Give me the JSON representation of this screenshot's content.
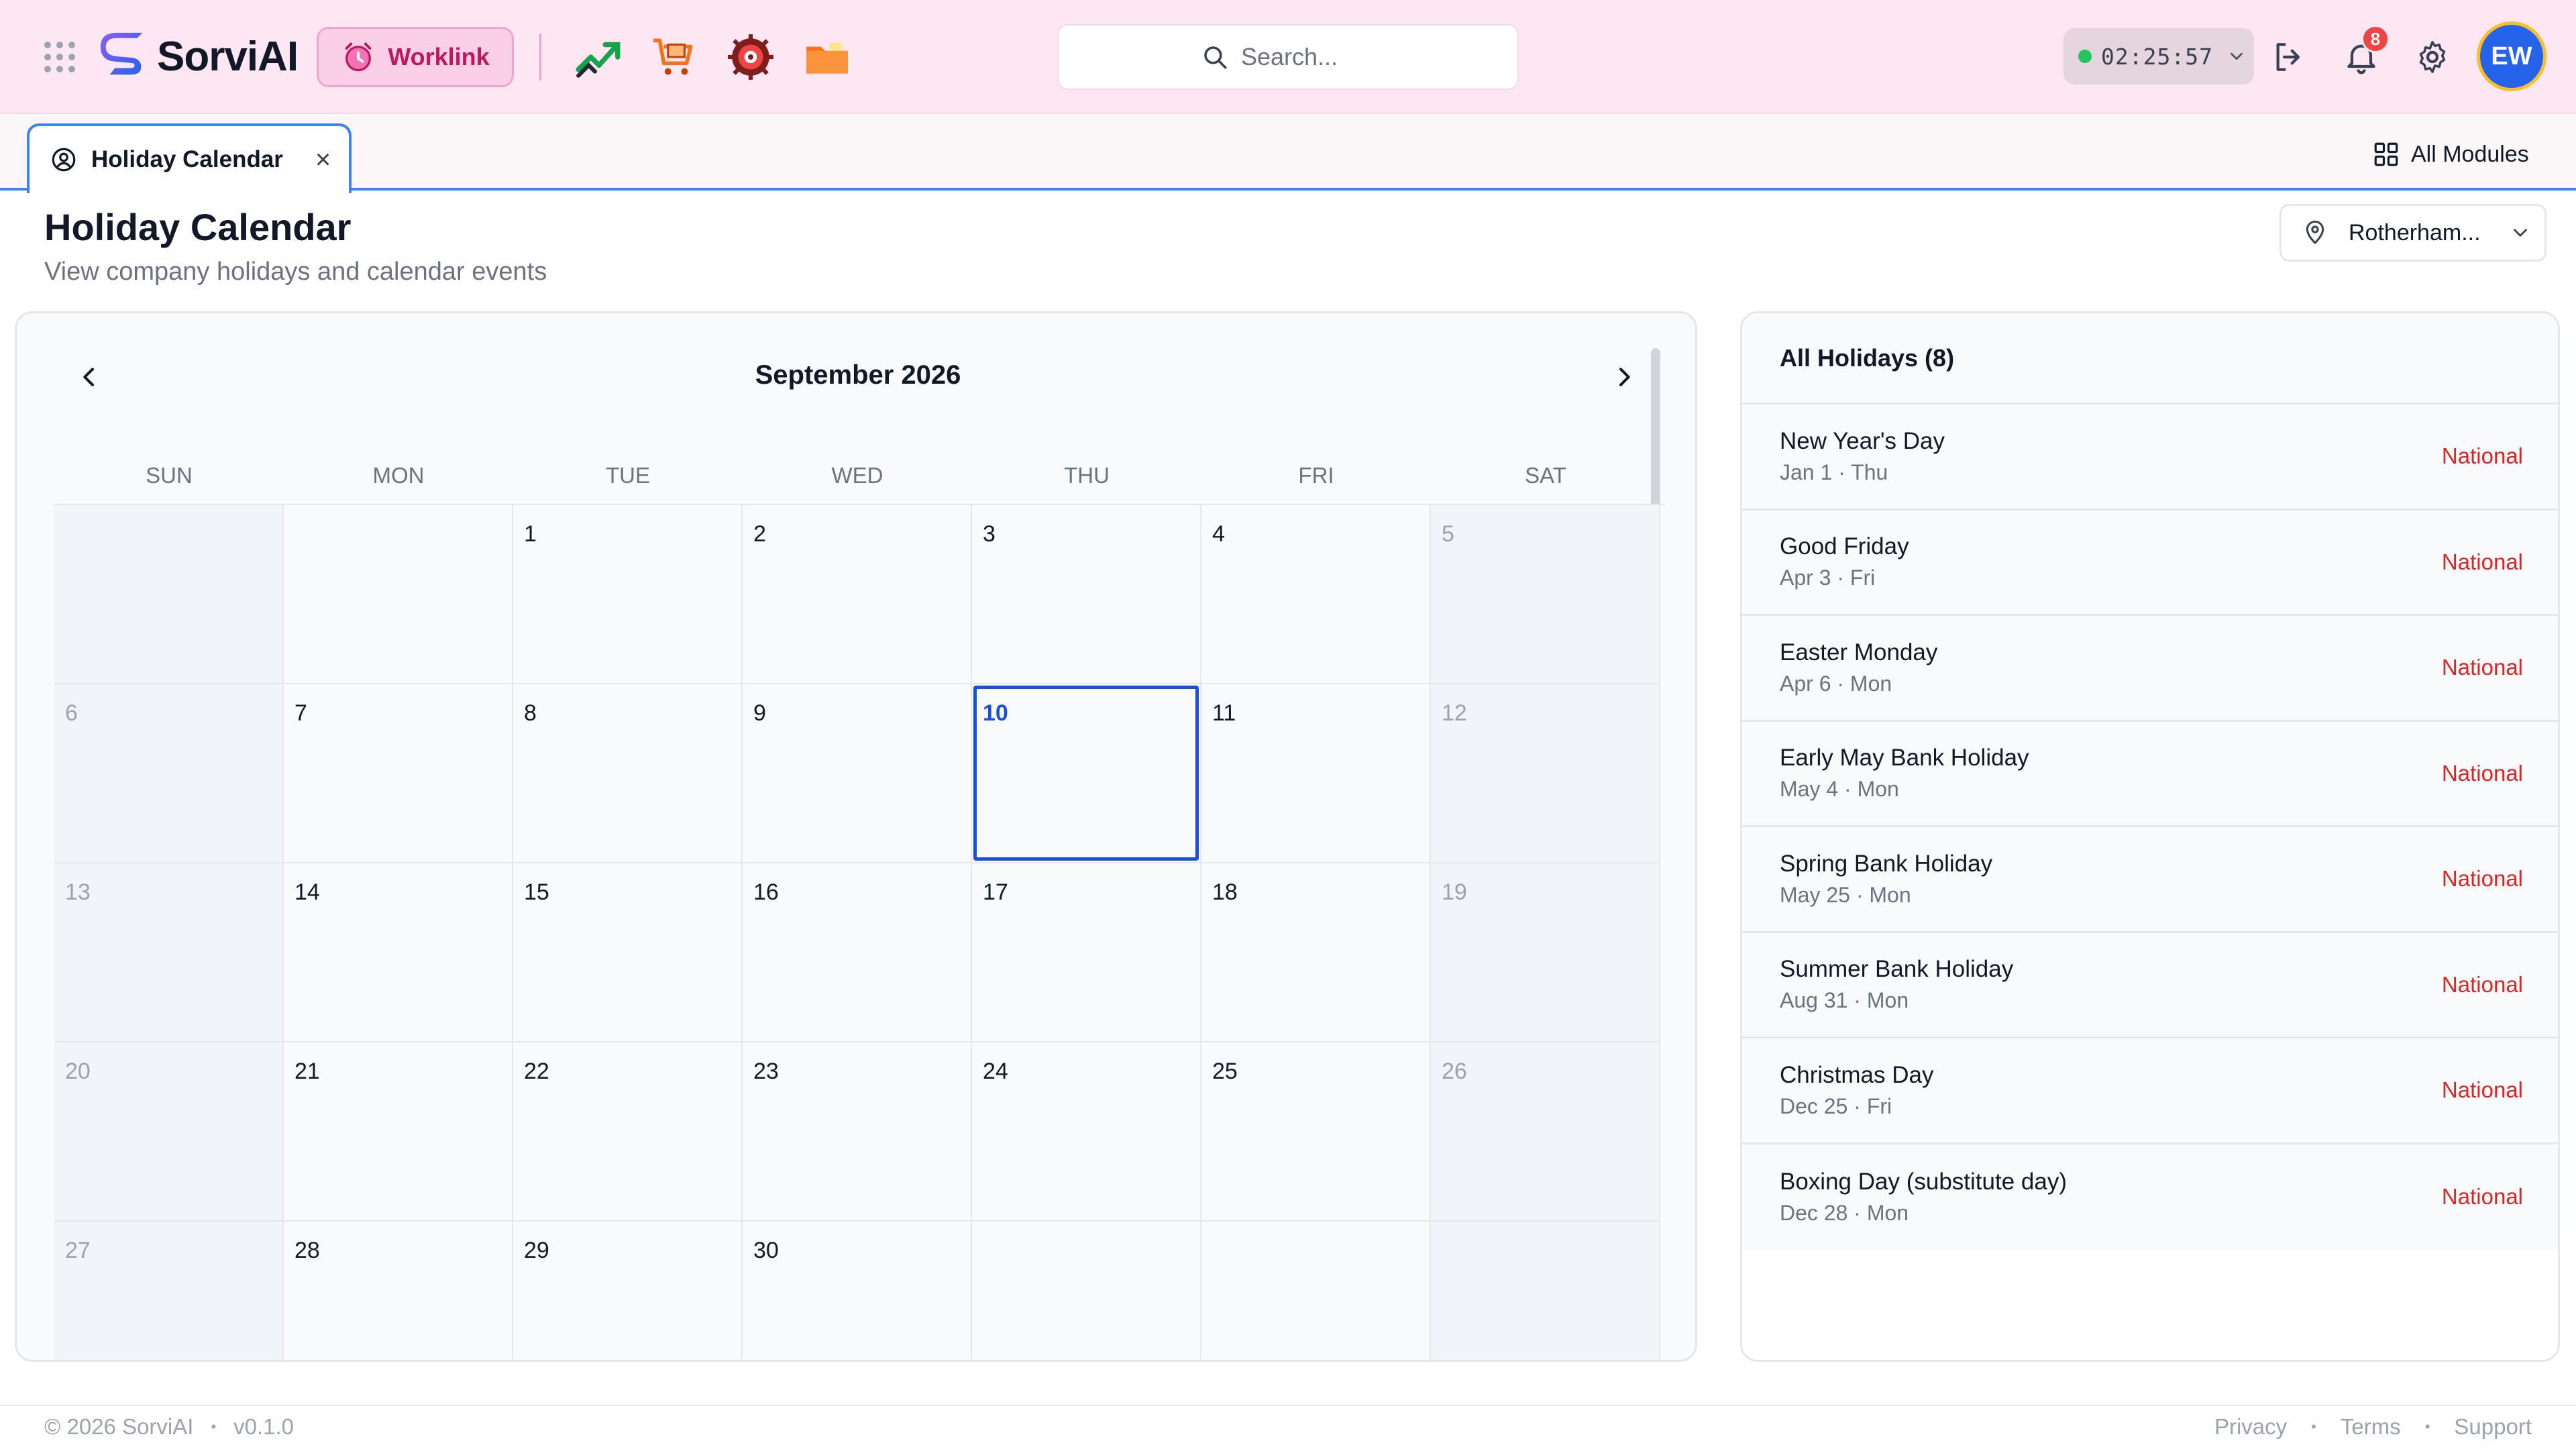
{
  "header": {
    "brand": "SorviAI",
    "workspace": "Worklink",
    "search_placeholder": "Search...",
    "timer": "02:25:57",
    "notifications_count": "8",
    "avatar_initials": "EW"
  },
  "tabs": {
    "active_label": "Holiday Calendar",
    "close_symbol": "×",
    "all_modules_label": "All Modules"
  },
  "page": {
    "title": "Holiday Calendar",
    "subtitle": "View company holidays and calendar events",
    "location": "Rotherham..."
  },
  "calendar": {
    "month_label": "September 2026",
    "weekdays": [
      "SUN",
      "MON",
      "TUE",
      "WED",
      "THU",
      "FRI",
      "SAT"
    ],
    "weeks": [
      [
        "",
        "",
        "1",
        "2",
        "3",
        "4",
        "5"
      ],
      [
        "6",
        "7",
        "8",
        "9",
        "10",
        "11",
        "12"
      ],
      [
        "13",
        "14",
        "15",
        "16",
        "17",
        "18",
        "19"
      ],
      [
        "20",
        "21",
        "22",
        "23",
        "24",
        "25",
        "26"
      ],
      [
        "27",
        "28",
        "29",
        "30",
        "",
        "",
        ""
      ]
    ],
    "selected_day": "10"
  },
  "holidays": {
    "title": "All Holidays (8)",
    "items": [
      {
        "name": "New Year's Day",
        "date": "Jan 1 · Thu",
        "type": "National"
      },
      {
        "name": "Good Friday",
        "date": "Apr 3 · Fri",
        "type": "National"
      },
      {
        "name": "Easter Monday",
        "date": "Apr 6 · Mon",
        "type": "National"
      },
      {
        "name": "Early May Bank Holiday",
        "date": "May 4 · Mon",
        "type": "National"
      },
      {
        "name": "Spring Bank Holiday",
        "date": "May 25 · Mon",
        "type": "National"
      },
      {
        "name": "Summer Bank Holiday",
        "date": "Aug 31 · Mon",
        "type": "National"
      },
      {
        "name": "Christmas Day",
        "date": "Dec 25 · Fri",
        "type": "National"
      },
      {
        "name": "Boxing Day (substitute day)",
        "date": "Dec 28 · Mon",
        "type": "National"
      }
    ]
  },
  "footer": {
    "copyright": "© 2026 SorviAI",
    "version": "v0.1.0",
    "bullet": "•",
    "links": [
      "Privacy",
      "Terms",
      "Support"
    ]
  },
  "colors": {
    "topbar_bg": "#fce7f3",
    "accent_blue": "#3b82f6",
    "today_border": "#1d4ed8",
    "holiday_type": "#dc2626",
    "status_online": "#22c55e",
    "badge": "#ef4444"
  },
  "icons": {
    "apps": "grid-dots-icon",
    "brand": "sorvi-logo-icon",
    "workspace": "alarm-clock-icon",
    "apps_bar": [
      "trending-chart-icon",
      "cart-box-icon",
      "target-gear-icon",
      "folder-icon"
    ],
    "search": "search-icon",
    "logout": "logout-icon",
    "notifications": "bell-icon",
    "settings": "gear-icon",
    "tab": "user-circle-icon",
    "all_modules": "grid-icon",
    "location": "map-pin-icon"
  }
}
